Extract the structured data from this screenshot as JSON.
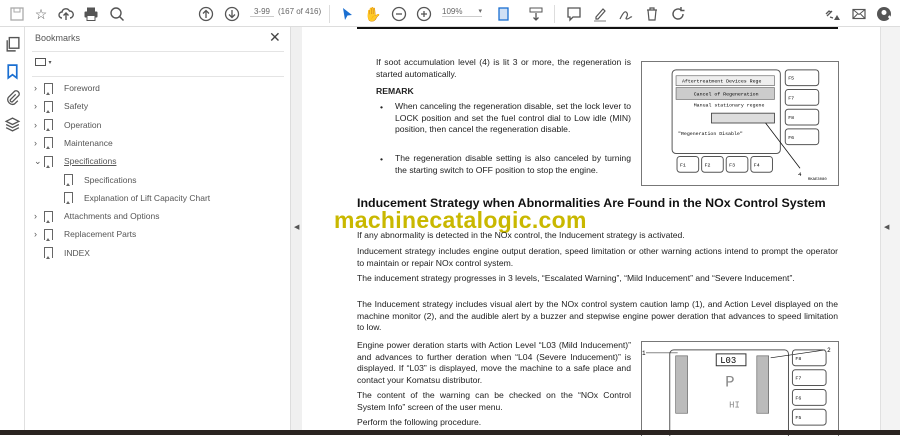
{
  "toolbar": {
    "page_label": "3-99",
    "page_count": "(167 of 416)",
    "zoom": "109%",
    "icons": [
      "save-icon",
      "bookmark-star-icon",
      "upload-cloud-icon",
      "print-icon",
      "find-icon",
      "prev-page-icon",
      "next-page-icon",
      "select-cursor-icon",
      "hand-icon",
      "zoom-out-icon",
      "zoom-in-icon",
      "fit-page-icon",
      "scroll-mode-icon",
      "comment-icon",
      "highlight-icon",
      "sign-icon",
      "delete-icon",
      "rotate-icon",
      "share-link-icon",
      "email-icon",
      "account-icon"
    ]
  },
  "bookmarks": {
    "title": "Bookmarks",
    "items": [
      {
        "label": "Foreword",
        "level": 0,
        "expandable": true
      },
      {
        "label": "Safety",
        "level": 0,
        "expandable": true
      },
      {
        "label": "Operation",
        "level": 0,
        "expandable": true
      },
      {
        "label": "Maintenance",
        "level": 0,
        "expandable": true
      },
      {
        "label": "Specifications",
        "level": 0,
        "expandable": true,
        "expanded": true
      },
      {
        "label": "Specifications",
        "level": 1
      },
      {
        "label": "Explanation of Lift Capacity Chart",
        "level": 1
      },
      {
        "label": "Attachments and Options",
        "level": 0,
        "expandable": true
      },
      {
        "label": "Replacement Parts",
        "level": 0,
        "expandable": true
      },
      {
        "label": "INDEX",
        "level": 0
      }
    ]
  },
  "document": {
    "p1": "If soot accumulation level (4) is lit 3 or more, the regeneration is started automatically.",
    "remark": "REMARK",
    "bullet1": "When canceling the regeneration disable, set the lock lever to LOCK position and set the fuel control dial to Low idle (MIN) position, then cancel the regeneration disable.",
    "bullet2": "The regeneration disable setting is also canceled by turning the starting switch to OFF position to stop the engine.",
    "heading": "Inducement Strategy when Abnormalities Are Found in the NOx Control System",
    "watermark": "machinecatalogic.com",
    "p2": "If any abnormality is detected in the NOx control, the Inducement strategy is activated.",
    "p3": "Inducement strategy includes engine output deration, speed limitation or other warning actions intend to prompt the operator to maintain or repair NOx control system.",
    "p4": "The inducement strategy progresses in 3 levels, “Escalated Warning”, “Mild Inducement” and “Severe Inducement”.",
    "p5": "The Inducement strategy includes visual alert by the NOx control system caution lamp (1), and Action Level displayed on the machine monitor (2), and the audible alert by a buzzer and stepwise engine power deration that advances to speed limitation to low.",
    "p6": "Engine power deration starts with Action Level “L03 (Mild Inducement)” and advances to further deration when “L04 (Severe Inducement)” is displayed. If “L03” is displayed, move the machine to a safe place and contact your Komatsu distributor.",
    "p7": "The content of the warning can be checked on the “NOx Control System Info” screen of the user menu.",
    "p8": "Perform the following procedure.",
    "fig1": {
      "line1": "Aftertreatment Devices Rege",
      "line2": "Cancel of Regeneration",
      "line3": "Manual stationary regene",
      "line4": "\"Regeneration Disable\"",
      "fkeys_right": [
        "F5",
        "F7",
        "F8",
        "F6"
      ],
      "fkeys_bottom": [
        "F1",
        "F2",
        "F3",
        "F4"
      ],
      "callout": "4",
      "code": "RKAE3080"
    },
    "fig2": {
      "level": "L03",
      "gear": "P",
      "mode": "HI",
      "fkeys_right": [
        "F8",
        "F7",
        "F6",
        "F5"
      ],
      "callouts": [
        "1",
        "2"
      ]
    }
  }
}
